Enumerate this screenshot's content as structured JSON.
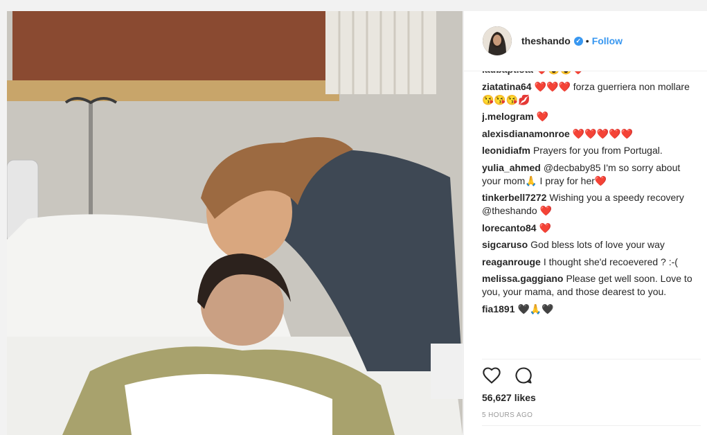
{
  "post": {
    "username": "theshando",
    "separator": "•",
    "follow_label": "Follow",
    "verified_icon": "verified-badge-icon",
    "likes": "56,627 likes",
    "time": "5 HOURS AGO",
    "photo_description_icon": "post-photo"
  },
  "comments": [
    {
      "user": "laubaptista",
      "text": "❤️😍😍❤️"
    },
    {
      "user": "ziatatina64",
      "text": "❤️❤️❤️ forza guerriera non mollare😘😘😘💋"
    },
    {
      "user": "j.melogram",
      "text": "❤️"
    },
    {
      "user": "alexisdianamonroe",
      "text": "❤️❤️❤️❤️❤️"
    },
    {
      "user": "leonidiafm",
      "text": "Prayers for you from Portugal."
    },
    {
      "user": "yulia_ahmed",
      "text": "@decbaby85 I'm so sorry about your mom🙏 I pray for her❤️"
    },
    {
      "user": "tinkerbell7272",
      "text": "Wishing you a speedy recovery @theshando ❤️"
    },
    {
      "user": "lorecanto84",
      "text": "❤️"
    },
    {
      "user": "sigcaruso",
      "text": "God bless lots of love your way"
    },
    {
      "user": "reaganrouge",
      "text": "I thought she'd recoevered ? :-("
    },
    {
      "user": "melissa.gaggiano",
      "text": "Please get well soon. Love to you, your mama, and those dearest to you."
    },
    {
      "user": "fia1891",
      "text": "🖤🙏🖤"
    }
  ],
  "icons": {
    "like": "heart-outline-icon",
    "comment": "comment-bubble-icon"
  }
}
